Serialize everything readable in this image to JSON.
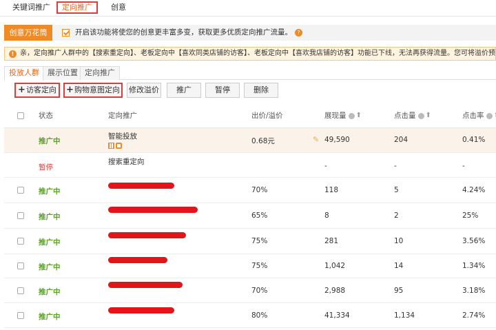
{
  "top_tabs": [
    {
      "label": "关键词推广"
    },
    {
      "label": "定向推广"
    },
    {
      "label": "创意"
    }
  ],
  "banner": {
    "button_label": "创意万花筒",
    "checkbox_checked": true,
    "text": "开启该功能将使您的创意更丰富多变，获取更多优质定向推广流量。"
  },
  "notice": {
    "text": "亲，定向推广人群中的【搜索重定向】、老板定向中【喜欢同类店铺的访客】、老板定向中【喜欢我店铺的访客】功能已下线，无法再获得流量。您可将溢价预算转移"
  },
  "sub_tabs": [
    {
      "label": "投放人群"
    },
    {
      "label": "展示位置"
    },
    {
      "label": "定向推广"
    }
  ],
  "actions": {
    "visitor": "访客定向",
    "shopping": "购物意图定向",
    "modify": "修改溢价",
    "promote": "推广",
    "pause": "暂停",
    "delete": "删除"
  },
  "columns": {
    "status": "状态",
    "target": "定向推广",
    "bid": "出价/溢价",
    "impressions": "展现量",
    "clicks": "点击量",
    "ctr": "点击率"
  },
  "rows": [
    {
      "status": "推广中",
      "target": "智能投放",
      "bid": "0.68元",
      "impressions": "49,590",
      "clicks": "204",
      "ctr": "0.41%"
    },
    {
      "status": "暂停",
      "target": "搜索重定向",
      "bid": "",
      "impressions": "-",
      "clicks": "-",
      "ctr": "-"
    },
    {
      "status": "推广中",
      "target": "",
      "bid": "70%",
      "impressions": "118",
      "clicks": "5",
      "ctr": "4.24%"
    },
    {
      "status": "推广中",
      "target": "",
      "bid": "65%",
      "impressions": "8",
      "clicks": "2",
      "ctr": "25%"
    },
    {
      "status": "推广中",
      "target": "",
      "bid": "75%",
      "impressions": "281",
      "clicks": "10",
      "ctr": "3.56%"
    },
    {
      "status": "推广中",
      "target": "",
      "bid": "75%",
      "impressions": "1,042",
      "clicks": "14",
      "ctr": "1.34%"
    },
    {
      "status": "推广中",
      "target": "",
      "bid": "70%",
      "impressions": "2,988",
      "clicks": "95",
      "ctr": "3.18%"
    },
    {
      "status": "推广中",
      "target": "",
      "bid": "80%",
      "impressions": "41,334",
      "clicks": "1,134",
      "ctr": "2.74%"
    }
  ],
  "colors": {
    "accent": "#f08a24",
    "active_status": "#5da12b",
    "paused_status": "#e23a3a",
    "redaction": "#e4141b"
  }
}
